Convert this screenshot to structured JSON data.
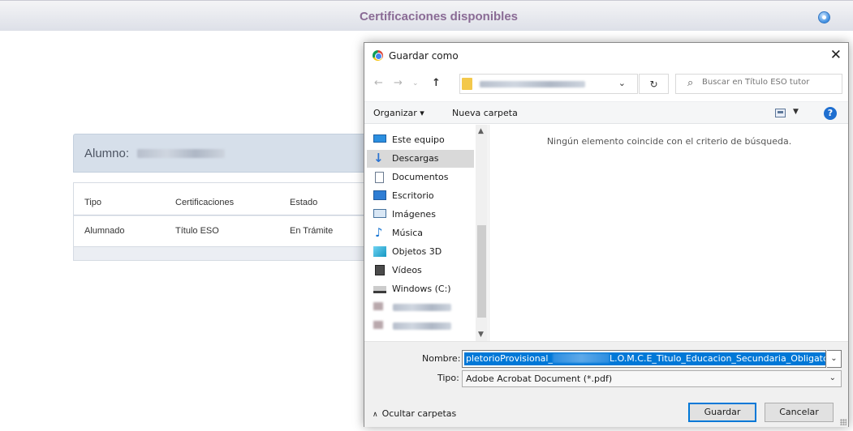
{
  "page": {
    "title": "Certificaciones disponibles",
    "student_label": "Alumno:",
    "table": {
      "headers": [
        "Tipo",
        "Certificaciones",
        "Estado"
      ],
      "rows": [
        [
          "Alumnado",
          "Título ESO",
          "En Trámite"
        ]
      ]
    }
  },
  "dialog": {
    "title": "Guardar como",
    "close_glyph": "✕",
    "search_placeholder": "Buscar en Título ESO tutor",
    "toolbar": {
      "organize": "Organizar ▾",
      "new_folder": "Nueva carpeta",
      "help": "?"
    },
    "nav_items": [
      {
        "label": "Este equipo",
        "icon": "computer-icon"
      },
      {
        "label": "Descargas",
        "icon": "downloads-icon",
        "selected": true
      },
      {
        "label": "Documentos",
        "icon": "documents-icon"
      },
      {
        "label": "Escritorio",
        "icon": "desktop-icon"
      },
      {
        "label": "Imágenes",
        "icon": "pictures-icon"
      },
      {
        "label": "Música",
        "icon": "music-icon"
      },
      {
        "label": "Objetos 3D",
        "icon": "objects-3d-icon"
      },
      {
        "label": "Vídeos",
        "icon": "videos-icon"
      },
      {
        "label": "Windows (C:)",
        "icon": "drive-icon"
      }
    ],
    "empty_message": "Ningún elemento coincide con el criterio de búsqueda.",
    "name_label": "Nombre:",
    "filename_start": "pletorioProvisional_",
    "filename_end": "L.O.M.C.E_Titulo_Educacion_Secundaria_Obligatoria.pdf",
    "type_label": "Tipo:",
    "type_value": "Adobe Acrobat Document (*.pdf)",
    "hide_folders": "Ocultar carpetas",
    "save_button": "Guardar",
    "cancel_button": "Cancelar"
  },
  "colors": {
    "title_purple": "#8a6b95",
    "student_panel": "#d6dfea",
    "selection_blue": "#0078d7"
  }
}
